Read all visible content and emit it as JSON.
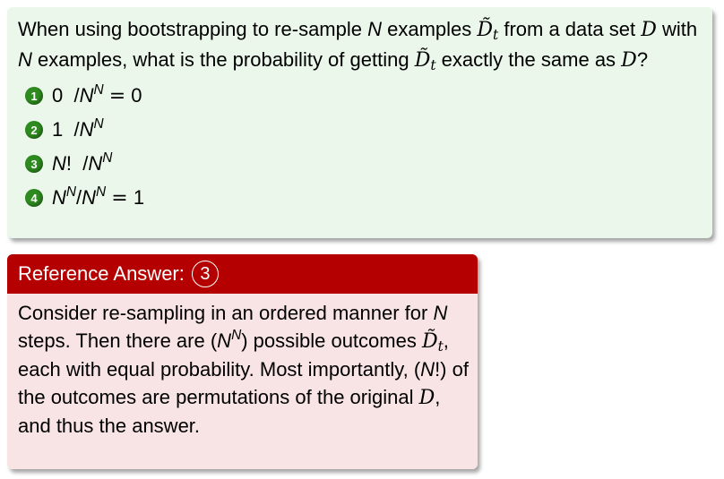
{
  "question": {
    "t1": "When using bootstrapping to re-sample ",
    "N": "N",
    "t2": " examples ",
    "Dt": "D",
    "t": "t",
    "t3": " from a data set ",
    "D": "D",
    "t4": " with ",
    "t5": " examples, what is the probability of getting ",
    "t6": " exactly the same as ",
    "t7": "?"
  },
  "choices": [
    {
      "num": "1",
      "text": "0  /N^N = 0"
    },
    {
      "num": "2",
      "text": "1  /N^N"
    },
    {
      "num": "3",
      "text": "N!  /N^N"
    },
    {
      "num": "4",
      "text": "N^N /N^N = 1"
    }
  ],
  "answer": {
    "header_label": "Reference Answer:",
    "header_num": "3",
    "s1": "Consider re-sampling in an ordered manner for ",
    "N": "N",
    "s2": " steps. Then there are (",
    "s3": ") possible outcomes ",
    "s4": ", each with equal probability. Most importantly, (",
    "s5": "!) of the outcomes are permutations of the original ",
    "s6": ", and thus the answer."
  },
  "colors": {
    "question_bg": "#eaf7ea",
    "number_badge": "#2e8b1f",
    "answer_header": "#b40000",
    "answer_bg": "#f8e4e4"
  }
}
